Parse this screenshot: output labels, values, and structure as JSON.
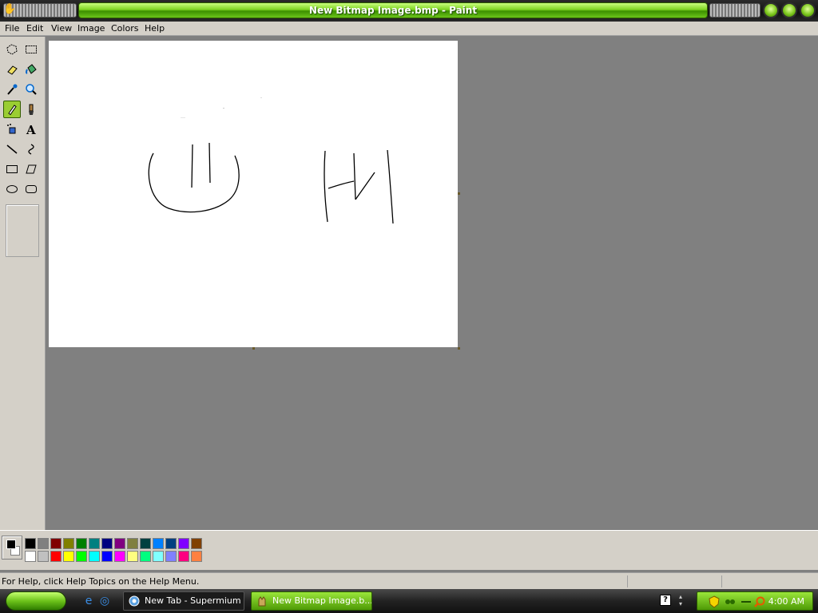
{
  "window": {
    "title": "New Bitmap Image.bmp - Paint"
  },
  "menu": [
    "File",
    "Edit",
    "View",
    "Image",
    "Colors",
    "Help"
  ],
  "tools": [
    {
      "name": "free-form-select-icon",
      "active": false
    },
    {
      "name": "select-icon",
      "active": false
    },
    {
      "name": "eraser-icon",
      "active": false
    },
    {
      "name": "fill-with-color-icon",
      "active": false
    },
    {
      "name": "pick-color-icon",
      "active": false
    },
    {
      "name": "magnifier-icon",
      "active": false
    },
    {
      "name": "pencil-icon",
      "active": true
    },
    {
      "name": "brush-icon",
      "active": false
    },
    {
      "name": "airbrush-icon",
      "active": false
    },
    {
      "name": "text-icon",
      "active": false
    },
    {
      "name": "line-icon",
      "active": false
    },
    {
      "name": "curve-icon",
      "active": false
    },
    {
      "name": "rectangle-icon",
      "active": false
    },
    {
      "name": "polygon-icon",
      "active": false
    },
    {
      "name": "ellipse-icon",
      "active": false
    },
    {
      "name": "rounded-rectangle-icon",
      "active": false
    }
  ],
  "palette": {
    "top": [
      "#000000",
      "#808080",
      "#800000",
      "#808000",
      "#008000",
      "#008080",
      "#000080",
      "#800080",
      "#808040",
      "#004040",
      "#0080ff",
      "#004080",
      "#8000ff",
      "#804000"
    ],
    "bottom": [
      "#ffffff",
      "#c0c0c0",
      "#ff0000",
      "#ffff00",
      "#00ff00",
      "#00ffff",
      "#0000ff",
      "#ff00ff",
      "#ffff80",
      "#00ff80",
      "#80ffff",
      "#8080ff",
      "#ff0080",
      "#ff8040"
    ],
    "foreground": "#000000",
    "background": "#ffffff"
  },
  "status": {
    "text": "For Help, click Help Topics on the Help Menu."
  },
  "taskbar": {
    "tasks": [
      {
        "label": "New Tab - Supermium",
        "active": false
      },
      {
        "label": "New Bitmap Image.b...",
        "active": true
      }
    ],
    "clock": "4:00 AM"
  }
}
